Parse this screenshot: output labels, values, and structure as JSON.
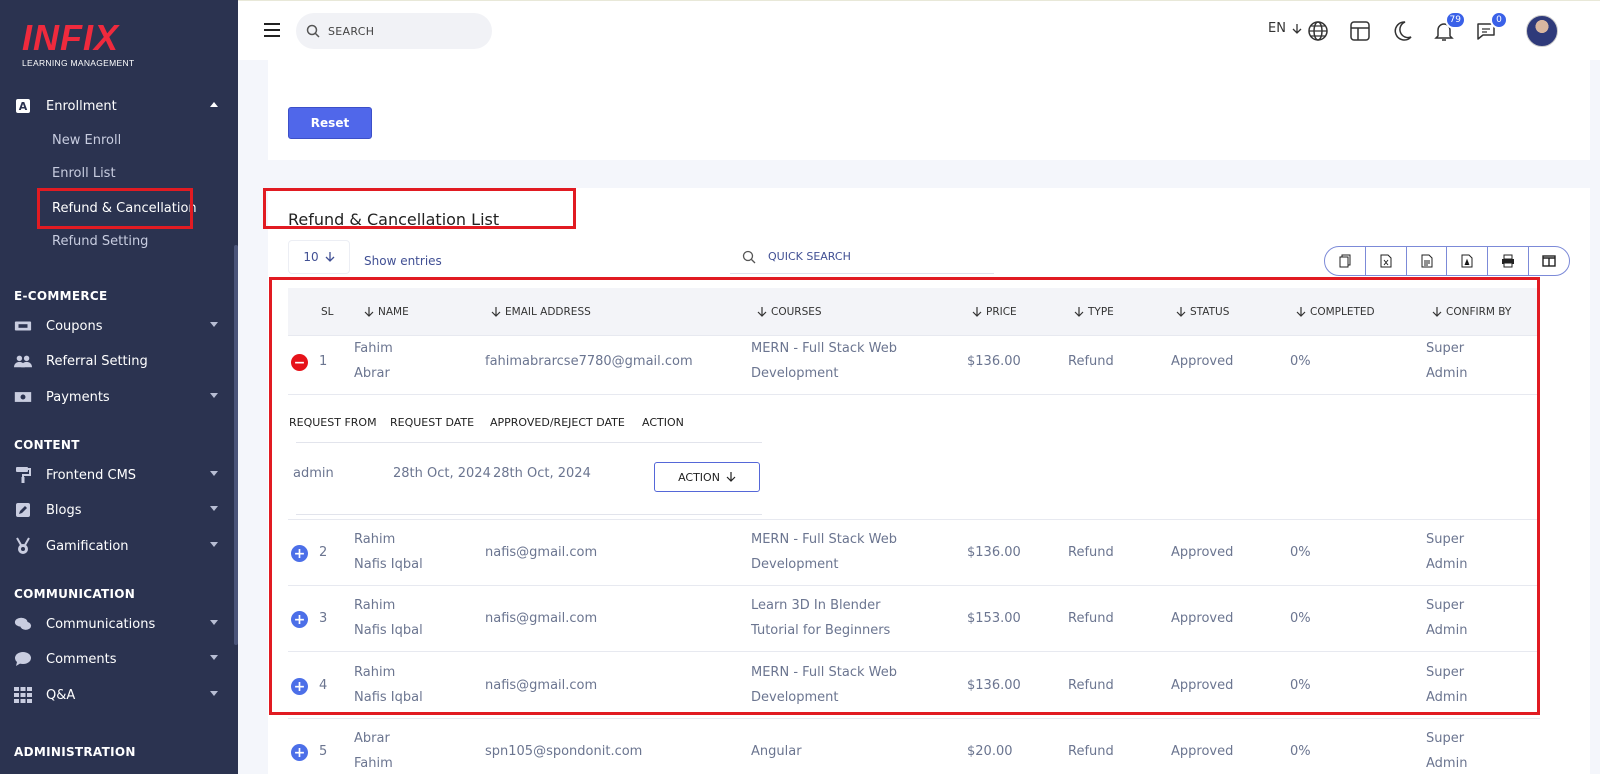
{
  "brand": {
    "logo_text": "INFIX",
    "tagline": "LEARNING MANAGEMENT"
  },
  "sidebar": {
    "enrollment": {
      "label": "Enrollment",
      "icon": "A",
      "children": [
        "New Enroll",
        "Enroll List",
        "Refund & Cancellation",
        "Refund Setting"
      ],
      "active_child": "Refund & Cancellation"
    },
    "sections": [
      {
        "title": "E-COMMERCE",
        "items": [
          "Coupons",
          "Referral Setting",
          "Payments"
        ]
      },
      {
        "title": "CONTENT",
        "items": [
          "Frontend CMS",
          "Blogs",
          "Gamification"
        ]
      },
      {
        "title": "COMMUNICATION",
        "items": [
          "Communications",
          "Comments",
          "Q&A"
        ]
      },
      {
        "title": "ADMINISTRATION",
        "items": []
      }
    ]
  },
  "header": {
    "search_placeholder": "SEARCH",
    "language": "EN",
    "notifications_count": "79",
    "messages_count": "0"
  },
  "filter_card": {
    "reset_label": "Reset"
  },
  "list": {
    "title": "Refund & Cancellation List",
    "entries_value": "10",
    "entries_label": "Show entries",
    "quick_search_placeholder": "QUICK SEARCH",
    "columns": [
      "SL",
      "NAME",
      "EMAIL ADDRESS",
      "COURSES",
      "PRICE",
      "TYPE",
      "STATUS",
      "COMPLETED",
      "CONFIRM BY"
    ],
    "rows": [
      {
        "sl": "1",
        "name1": "Fahim",
        "name2": "Abrar",
        "email": "fahimabrarcse7780@gmail.com",
        "course1": "MERN - Full Stack Web",
        "course2": "Development",
        "price": "$136.00",
        "type": "Refund",
        "status": "Approved",
        "completed": "0%",
        "confirm1": "Super",
        "confirm2": "Admin"
      },
      {
        "sl": "2",
        "name1": "Rahim",
        "name2": "Nafis Iqbal",
        "email": "nafis@gmail.com",
        "course1": "MERN - Full Stack Web",
        "course2": "Development",
        "price": "$136.00",
        "type": "Refund",
        "status": "Approved",
        "completed": "0%",
        "confirm1": "Super",
        "confirm2": "Admin"
      },
      {
        "sl": "3",
        "name1": "Rahim",
        "name2": "Nafis Iqbal",
        "email": "nafis@gmail.com",
        "course1": "Learn 3D In Blender",
        "course2": "Tutorial for Beginners",
        "price": "$153.00",
        "type": "Refund",
        "status": "Approved",
        "completed": "0%",
        "confirm1": "Super",
        "confirm2": "Admin"
      },
      {
        "sl": "4",
        "name1": "Rahim",
        "name2": "Nafis Iqbal",
        "email": "nafis@gmail.com",
        "course1": "MERN - Full Stack Web",
        "course2": "Development",
        "price": "$136.00",
        "type": "Refund",
        "status": "Approved",
        "completed": "0%",
        "confirm1": "Super",
        "confirm2": "Admin"
      },
      {
        "sl": "5",
        "name1": "Abrar",
        "name2": "Fahim",
        "email": "spn105@spondonit.com",
        "course1": "Angular",
        "course2": "",
        "price": "$20.00",
        "type": "Refund",
        "status": "Approved",
        "completed": "0%",
        "confirm1": "Super",
        "confirm2": "Admin"
      }
    ],
    "child": {
      "columns": [
        "REQUEST FROM",
        "REQUEST DATE",
        "APPROVED/REJECT DATE",
        "ACTION"
      ],
      "values": {
        "request_from": "admin",
        "request_date": "28th Oct, 2024",
        "approved_date": "28th Oct, 2024",
        "action_label": "ACTION"
      }
    }
  },
  "colors": {
    "sidebar_bg": "#2b3350",
    "accent": "#5067ea",
    "highlight": "#e11b22",
    "brand": "#ef2a3d"
  }
}
